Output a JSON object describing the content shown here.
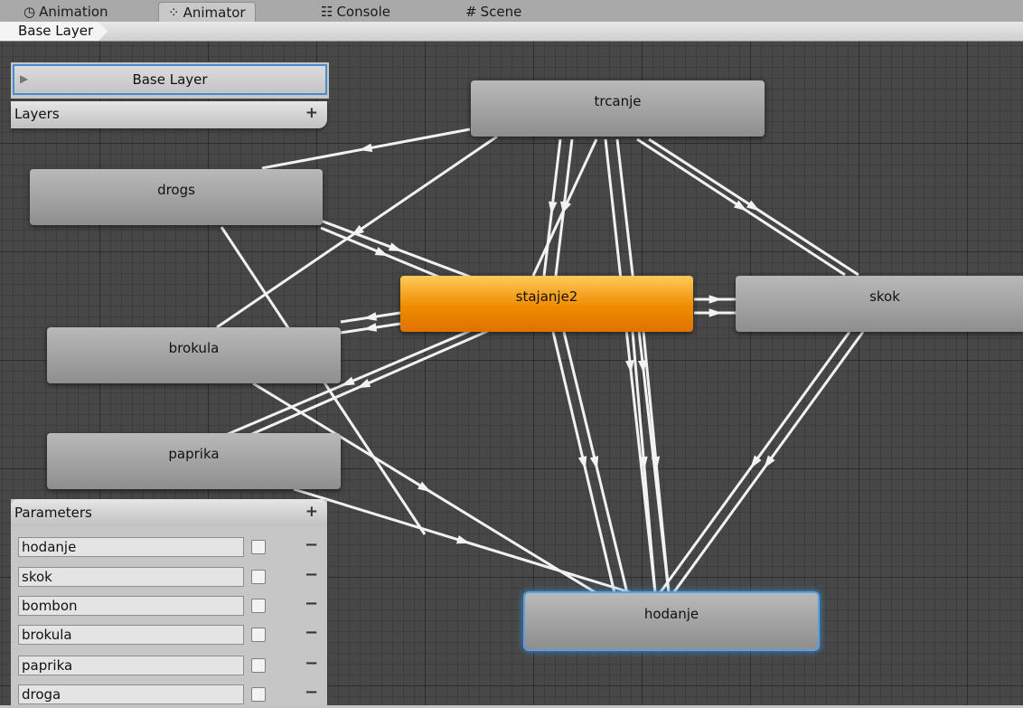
{
  "tabs": [
    {
      "label": "Animation",
      "icon": "clock-icon",
      "glyph": "◷"
    },
    {
      "label": "Animator",
      "icon": "animator-icon",
      "glyph": "⁘"
    },
    {
      "label": "Console",
      "icon": "console-icon",
      "glyph": "☷"
    },
    {
      "label": "Scene",
      "icon": "scene-icon",
      "glyph": "#"
    }
  ],
  "breadcrumb": "Base Layer",
  "layers": {
    "current": "Base Layer",
    "header": "Layers",
    "add_label": "+"
  },
  "states": {
    "trcanje": "trcanje",
    "drogs": "drogs",
    "stajanje2": "stajanje2",
    "skok": "skok",
    "brokula": "brokula",
    "paprika": "paprika",
    "hodanje": "hodanje"
  },
  "parameters": {
    "header": "Parameters",
    "add_label": "+",
    "remove_label": "−",
    "items": [
      "hodanje",
      "skok",
      "bombon",
      "brokula",
      "paprika",
      "droga"
    ]
  },
  "colors": {
    "default_state": "#ef8b00",
    "selection": "#3f8fd8",
    "graph_bg": "#474747"
  }
}
